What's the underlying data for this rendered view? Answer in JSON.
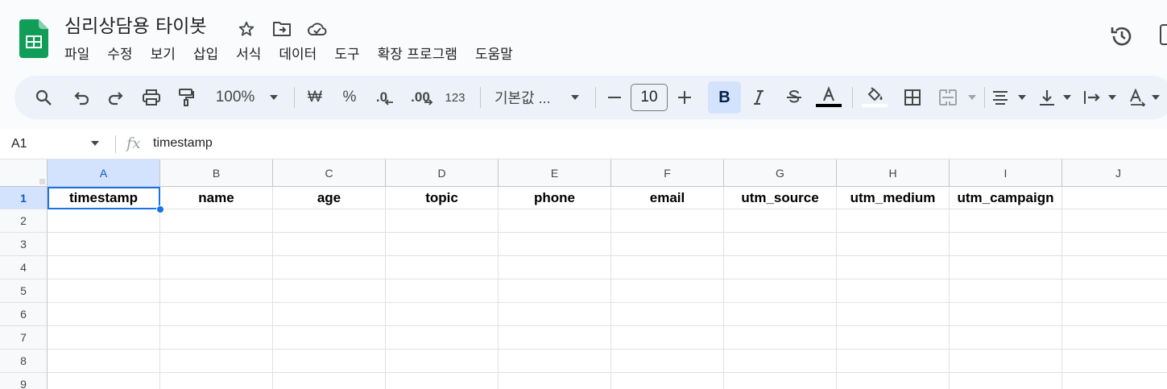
{
  "doc": {
    "title": "심리상담용 타이봇"
  },
  "menu": [
    "파일",
    "수정",
    "보기",
    "삽입",
    "서식",
    "데이터",
    "도구",
    "확장 프로그램",
    "도움말"
  ],
  "toolbar": {
    "zoom": "100%",
    "currency": "₩",
    "percent": "%",
    "decrease_decimal": ".0",
    "increase_decimal": ".00",
    "number_format": "123",
    "font": "기본값 ...",
    "font_size": "10",
    "bold": "B"
  },
  "formula_bar": {
    "cell_ref": "A1",
    "fx": "fx",
    "value": "timestamp"
  },
  "columns": [
    "A",
    "B",
    "C",
    "D",
    "E",
    "F",
    "G",
    "H",
    "I",
    "J"
  ],
  "rows": [
    "1",
    "2",
    "3",
    "4",
    "5",
    "6",
    "7",
    "8",
    "9"
  ],
  "header_row": [
    "timestamp",
    "name",
    "age",
    "topic",
    "phone",
    "email",
    "utm_source",
    "utm_medium",
    "utm_campaign",
    ""
  ],
  "colors": {
    "accent": "#1a73e8",
    "selected_header": "#d3e3fd",
    "sheets_green": "#0f9d58"
  }
}
